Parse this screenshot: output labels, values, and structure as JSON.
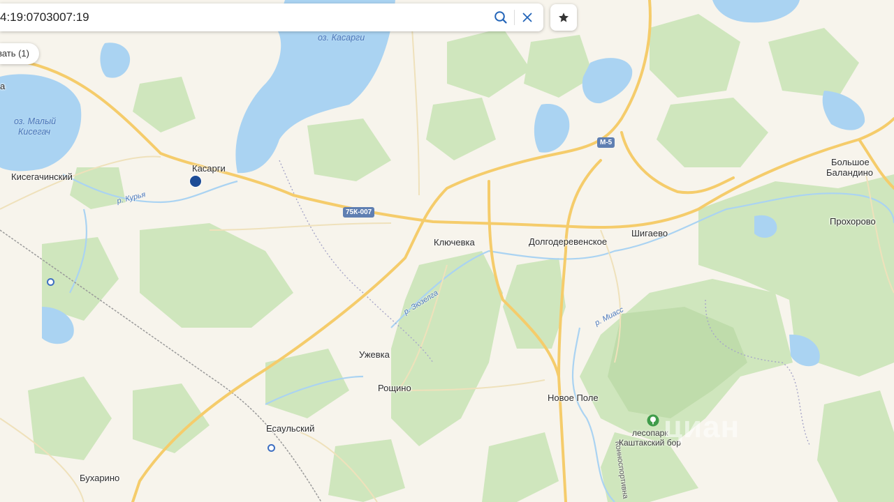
{
  "search": {
    "query": "4:19:0703007:19"
  },
  "buttons": {
    "show_label": "вать (1)"
  },
  "roads": {
    "m5": "М-5",
    "r75k": "75К-007"
  },
  "places": {
    "kasargi": "Касарги",
    "kisegachinsky": "Кисегачинский",
    "klyuchevka": "Ключевка",
    "dolgoderevenskoe": "Долгодеревенское",
    "shigaevo": "Шигаево",
    "bolshoe_balandino_1": "Большое",
    "bolshoe_balandino_2": "Баландино",
    "prokhorovo": "Прохорово",
    "uzhevka": "Ужевка",
    "roshchino": "Рощино",
    "novoe_pole": "Новое Поле",
    "esaulsky": "Есаульский",
    "bukharino": "Бухарино",
    "edge_a": "а"
  },
  "water": {
    "kasargi_lake": "оз. Касарги",
    "maly_kisegach_1": "оз. Малый",
    "maly_kisegach_2": "Кисегач",
    "river_kurya": "р. Курья",
    "river_zyuzelga": "р. Зюзелга",
    "river_miass": "р. Миасс"
  },
  "park": {
    "line1": "лесопарк",
    "line2": "Каштакский бор"
  },
  "streets": {
    "konnosportivnaya": "Конноспортивна"
  },
  "watermark": "циан",
  "colors": {
    "land": "#f7f4ec",
    "forest": "#cfe6bd",
    "water": "#aad3f2",
    "major_road": "#f5cc6b",
    "minor_road": "#f2e2b6",
    "marker": "#1d4c96",
    "accent": "#2264b8"
  },
  "icons": {
    "search": "search-icon",
    "clear": "close-icon",
    "favorite": "star-icon",
    "park": "tree-icon"
  }
}
